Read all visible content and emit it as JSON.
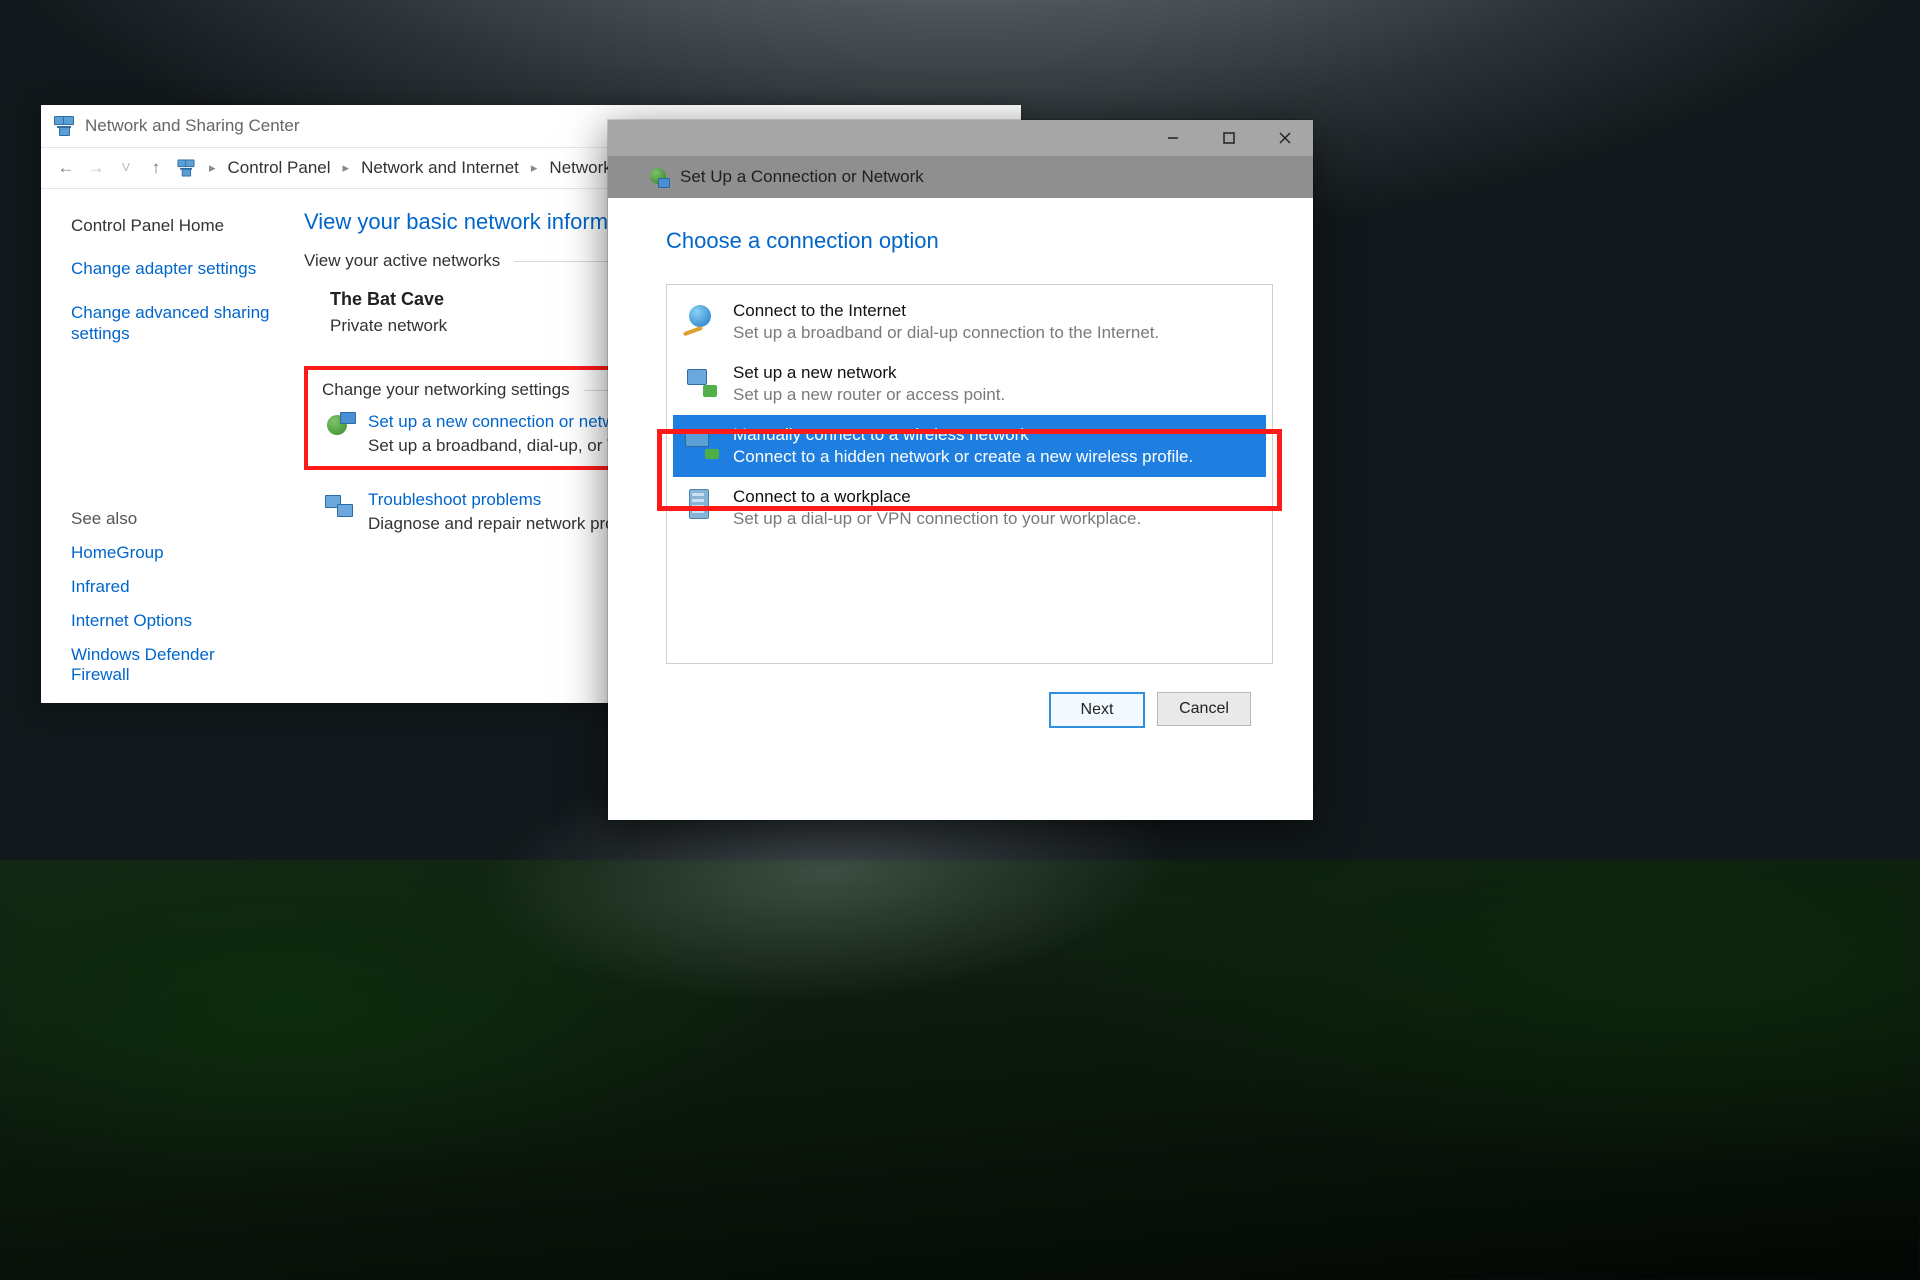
{
  "nsc": {
    "title": "Network and Sharing Center",
    "breadcrumb": {
      "a": "Control Panel",
      "b": "Network and Internet",
      "c": "Network and Sharing Ce"
    },
    "left": {
      "home": "Control Panel Home",
      "adapter": "Change adapter settings",
      "advshare": "Change advanced sharing settings",
      "seealso": "See also",
      "homegroup": "HomeGroup",
      "infrared": "Infrared",
      "inetopt": "Internet Options",
      "firewall": "Windows Defender Firewall"
    },
    "main": {
      "heading": "View your basic network information and",
      "active_label": "View your active networks",
      "net_name": "The Bat Cave",
      "net_type": "Private network",
      "change_label": "Change your networking settings",
      "task1_link": "Set up a new connection or network",
      "task1_desc": "Set up a broadband, dial-up, or VPN conne",
      "task2_link": "Troubleshoot problems",
      "task2_desc": "Diagnose and repair network problems, or g"
    }
  },
  "wizard": {
    "title": "Set Up a Connection or Network",
    "heading": "Choose a connection option",
    "options": [
      {
        "title": "Connect to the Internet",
        "desc": "Set up a broadband or dial-up connection to the Internet."
      },
      {
        "title": "Set up a new network",
        "desc": "Set up a new router or access point."
      },
      {
        "title": "Manually connect to a wireless network",
        "desc": "Connect to a hidden network or create a new wireless profile."
      },
      {
        "title": "Connect to a workplace",
        "desc": "Set up a dial-up or VPN connection to your workplace."
      }
    ],
    "buttons": {
      "next": "Next",
      "cancel": "Cancel"
    }
  }
}
